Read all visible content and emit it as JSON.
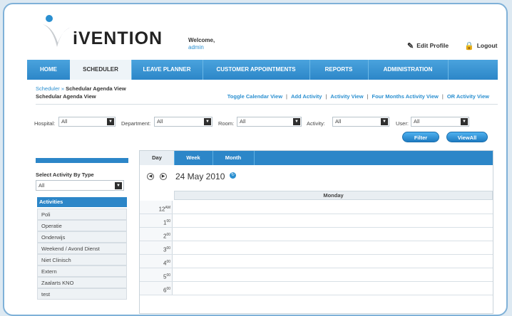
{
  "header": {
    "logo_text": "iVENTION",
    "welcome_label": "Welcome,",
    "welcome_user": "admin",
    "edit_profile": "Edit Profile",
    "logout": "Logout"
  },
  "nav": {
    "items": [
      "HOME",
      "SCHEDULER",
      "LEAVE PLANNER",
      "CUSTOMER APPOINTMENTS",
      "REPORTS",
      "ADMINISTRATION"
    ],
    "active": "SCHEDULER"
  },
  "breadcrumb": {
    "root": "Scheduler »",
    "current": "Schedular Agenda View"
  },
  "page_title": "Schedular Agenda View",
  "view_links": [
    "Toggle Calendar View",
    "Add Activity",
    "Activity View",
    "Four Months Activity View",
    "OR Activity View"
  ],
  "filters": {
    "hospital": {
      "label": "Hospital:",
      "value": "All"
    },
    "department": {
      "label": "Department:",
      "value": "All"
    },
    "room": {
      "label": "Room:",
      "value": "All"
    },
    "activity": {
      "label": "Activity:",
      "value": "All"
    },
    "user": {
      "label": "User:",
      "value": "All"
    },
    "filter_button": "Filter",
    "viewall_button": "ViewAll"
  },
  "left_panel": {
    "select_label": "Select Activity By Type",
    "select_value": "All",
    "activities_header": "Activities",
    "activities": [
      "Poli",
      "Operatie",
      "Onderwijs",
      "Weekend / Avond Dienst",
      "Niet Clinisch",
      "Extern",
      "Zaalarts KNO",
      "test"
    ]
  },
  "calendar": {
    "tabs": [
      "Day",
      "Week",
      "Month"
    ],
    "active_tab": "Day",
    "date": "24 May 2010",
    "day_header": "Monday",
    "hours": [
      {
        "h": "12",
        "sup": "AM"
      },
      {
        "h": "1",
        "sup": "00"
      },
      {
        "h": "2",
        "sup": "00"
      },
      {
        "h": "3",
        "sup": "00"
      },
      {
        "h": "4",
        "sup": "00"
      },
      {
        "h": "5",
        "sup": "00"
      },
      {
        "h": "6",
        "sup": "00"
      }
    ]
  },
  "colors": {
    "accent": "#2c86c8",
    "link": "#2a8fd0"
  },
  "icons": [
    "logo-v-icon",
    "edit-profile-icon",
    "logout-icon",
    "prev-icon",
    "next-icon",
    "refresh-icon",
    "dropdown-arrow-icon"
  ]
}
